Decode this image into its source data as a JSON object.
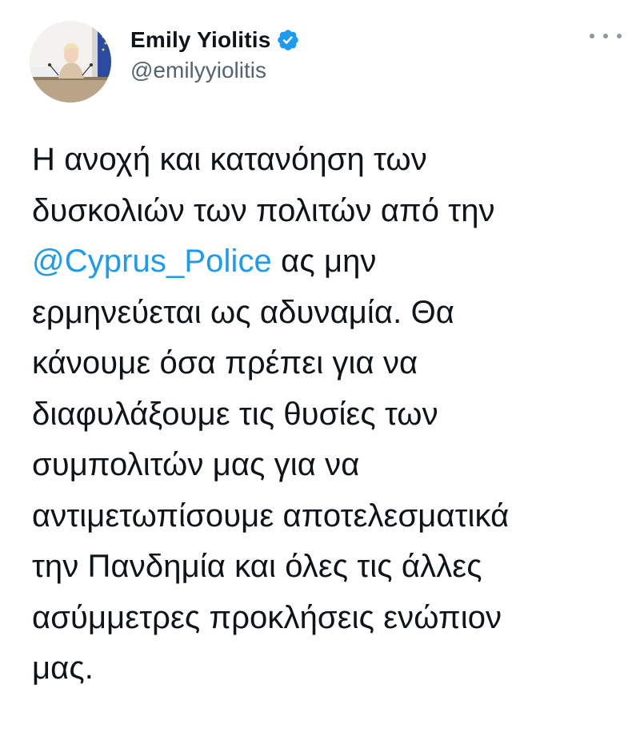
{
  "author": {
    "display_name": "Emily Yiolitis",
    "handle": "@emilyyiolitis",
    "verified_icon": "verified-badge-icon",
    "avatar_icon": "profile-photo"
  },
  "menu": {
    "more_icon": "more-horizontal-icon"
  },
  "tweet": {
    "lines": [
      "Η ανοχή και κατανόηση των",
      "δυσκολιών των πολιτών από την",
      "ας μην",
      "ερμηνεύεται ως αδυναμία. Θα",
      "κάνουμε όσα πρέπει για να",
      "διαφυλάξουμε τις θυσίες των",
      "συμπολιτών μας για να",
      "αντιμετωπίσουμε αποτελεσματικά",
      "την Πανδημία και όλες τις άλλες",
      "ασύμμετρες προκλήσεις ενώπιον",
      "μας."
    ],
    "mention": "@Cyprus_Police"
  },
  "colors": {
    "text": "#0f1419",
    "secondary": "#536471",
    "link": "#1d9bf0",
    "verified": "#1d9bf0"
  }
}
